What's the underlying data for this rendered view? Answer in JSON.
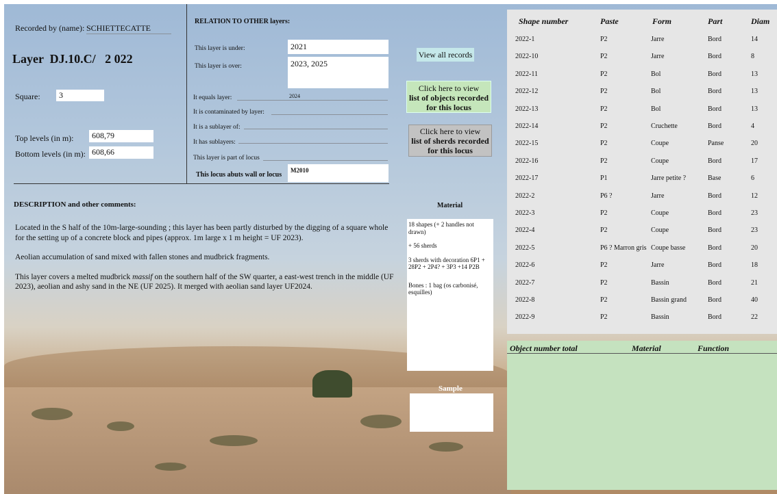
{
  "header": {
    "recorded_by_label": "Recorded by (name):",
    "recorded_by_value": "SCHIETTECATTE",
    "layer_title": "Layer  DJ.10.C/   2 022",
    "square_label": "Square:",
    "square_value": "3",
    "top_levels_label": "Top levels (in m):",
    "top_levels_value": "608,79",
    "bottom_levels_label": "Bottom levels (in m):",
    "bottom_levels_value": "608,66"
  },
  "relations": {
    "title": "RELATION TO OTHER layers:",
    "under_label": "This layer is under:",
    "under_value": "2021",
    "over_label": "This layer is over:",
    "over_value": "2023, 2025",
    "equals_label": "It equals layer:",
    "equals_value": "2024",
    "contaminated_label": "It is contaminated by layer:",
    "sublayer_of_label": "It is a sublayer of:",
    "has_sublayers_label": "It has sublayers:",
    "part_of_locus_label": "This layer is part of locus",
    "abuts_label": "This locus abuts wall or locus",
    "abuts_value": "M2010"
  },
  "buttons": {
    "view_all": "View all records",
    "objects_line1": "Click here to view",
    "objects_line2": "list of objects recorded for this locus",
    "sherds_line1": "Click here to view",
    "sherds_line2": "list of sherds recorded for this locus"
  },
  "description": {
    "title": "DESCRIPTION and other comments:",
    "p1": "Located in the S half of the 10m-large-sounding ; this layer has been partly disturbed by the digging of a square whole for the setting up of a concrete block and pipes (approx. 1m large x 1 m height = UF 2023).",
    "p2": "Aeolian accumulation of sand mixed with fallen stones and mudbrick fragments.",
    "p3_a": "This layer covers a melted mudbrick ",
    "p3_em": "massif",
    "p3_b": " on the southern half of the SW quarter, a east-west trench in the middle (UF 2023), aeolian and ashy sand in the NE (UF 2025). It merged with aeolian sand layer UF2024."
  },
  "material": {
    "title": "Material",
    "line1": "18 shapes (+ 2 handles not drawn)",
    "line2": "+ 56 sherds",
    "line3": "3 sherds with decoration 6P1 + 28P2 + 2P4? + 3P3 +14 P2B",
    "line4": "Bones : 1 bag (os carbonisé, esquilles)"
  },
  "sample": {
    "title": "Sample"
  },
  "shapes_table": {
    "headers": [
      "Shape number",
      "Paste",
      "Form",
      "Part",
      "Diam"
    ],
    "rows": [
      [
        "2022-1",
        "P2",
        "Jarre",
        "Bord",
        "14"
      ],
      [
        "2022-10",
        "P2",
        "Jarre",
        "Bord",
        "8"
      ],
      [
        "2022-11",
        "P2",
        "Bol",
        "Bord",
        "13"
      ],
      [
        "2022-12",
        "P2",
        "Bol",
        "Bord",
        "13"
      ],
      [
        "2022-13",
        "P2",
        "Bol",
        "Bord",
        "13"
      ],
      [
        "2022-14",
        "P2",
        "Cruchette",
        "Bord",
        "4"
      ],
      [
        "2022-15",
        "P2",
        "Coupe",
        "Panse",
        "20"
      ],
      [
        "2022-16",
        "P2",
        "Coupe",
        "Bord",
        "17"
      ],
      [
        "2022-17",
        "P1",
        "Jarre petite ?",
        "Base",
        "6"
      ],
      [
        "2022-2",
        "P6 ?",
        "Jarre",
        "Bord",
        "12"
      ],
      [
        "2022-3",
        "P2",
        "Coupe",
        "Bord",
        "23"
      ],
      [
        "2022-4",
        "P2",
        "Coupe",
        "Bord",
        "23"
      ],
      [
        "2022-5",
        "P6 ? Marron gris",
        "Coupe basse",
        "Bord",
        "20"
      ],
      [
        "2022-6",
        "P2",
        "Jarre",
        "Bord",
        "18"
      ],
      [
        "2022-7",
        "P2",
        "Bassin",
        "Bord",
        "21"
      ],
      [
        "2022-8",
        "P2",
        "Bassin grand",
        "Bord",
        "40"
      ],
      [
        "2022-9",
        "P2",
        "Bassin",
        "Bord",
        "22"
      ]
    ]
  },
  "objects_table": {
    "headers": [
      "Object number total",
      "Material",
      "Function"
    ]
  }
}
